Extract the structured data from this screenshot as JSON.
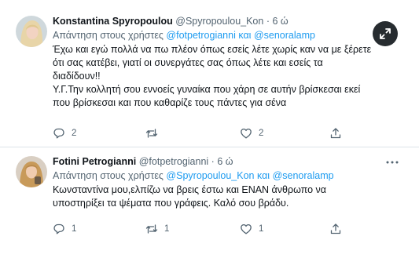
{
  "tweets": [
    {
      "author_name": "Konstantina Spyropoulou",
      "author_handle": "@Spyropoulou_Kon",
      "separator": "·",
      "time": "6 ώ",
      "reply_prefix": "Απάντηση στους χρήστες",
      "reply_mention_1": "@fotpetrogianni",
      "reply_and": "και",
      "reply_mention_2": "@senoralamp",
      "text_lines": [
        "Έχω και εγώ πολλά να πω πλέον όπως εσείς λέτε χωρίς καν να με ξέρετε",
        "ότι σας κατέβει, γιατί οι συνεργάτες σας όπως λέτε και εσείς τα",
        "διαδίδουν!!",
        "Υ.Γ.Την κολλητή σου εννοείς γυναίκα που χάρη σε αυτήν βρίσκεσαι εκεί",
        "που βρίσκεσαι και που καθαρίζε τους πάντες για σένα"
      ],
      "reply_count": "2",
      "retweet_count": "",
      "like_count": "2",
      "avatar_colors": {
        "bg": "#cfd8dc",
        "hair": "#e8d5a8",
        "face": "#f2d3c2"
      }
    },
    {
      "author_name": "Fotini Petrogianni",
      "author_handle": "@fotpetrogianni",
      "separator": "·",
      "time": "6 ώ",
      "reply_prefix": "Απάντηση στους χρήστες",
      "reply_mention_1": "@Spyropoulou_Kon",
      "reply_and": "και",
      "reply_mention_2": "@senoralamp",
      "text_lines": [
        "Κωνσταντίνα μου,ελπίζω να βρεις έστω και ΕΝΑΝ άνθρωπο να",
        "υποστηρίξει τα ψέματα που γράφεις. Καλό σου βράδυ."
      ],
      "reply_count": "1",
      "retweet_count": "1",
      "like_count": "1",
      "avatar_colors": {
        "bg": "#d9cfc3",
        "hair": "#c89a5a",
        "face": "#f0ccb0"
      }
    }
  ],
  "colors": {
    "text": "#0f1419",
    "secondary": "#536471",
    "link": "#1d9bf0",
    "divider": "#dde3e8",
    "expand_bg": "#272c30"
  },
  "icons": [
    "expand-icon",
    "more-icon",
    "reply-icon",
    "retweet-icon",
    "like-icon",
    "share-icon"
  ]
}
